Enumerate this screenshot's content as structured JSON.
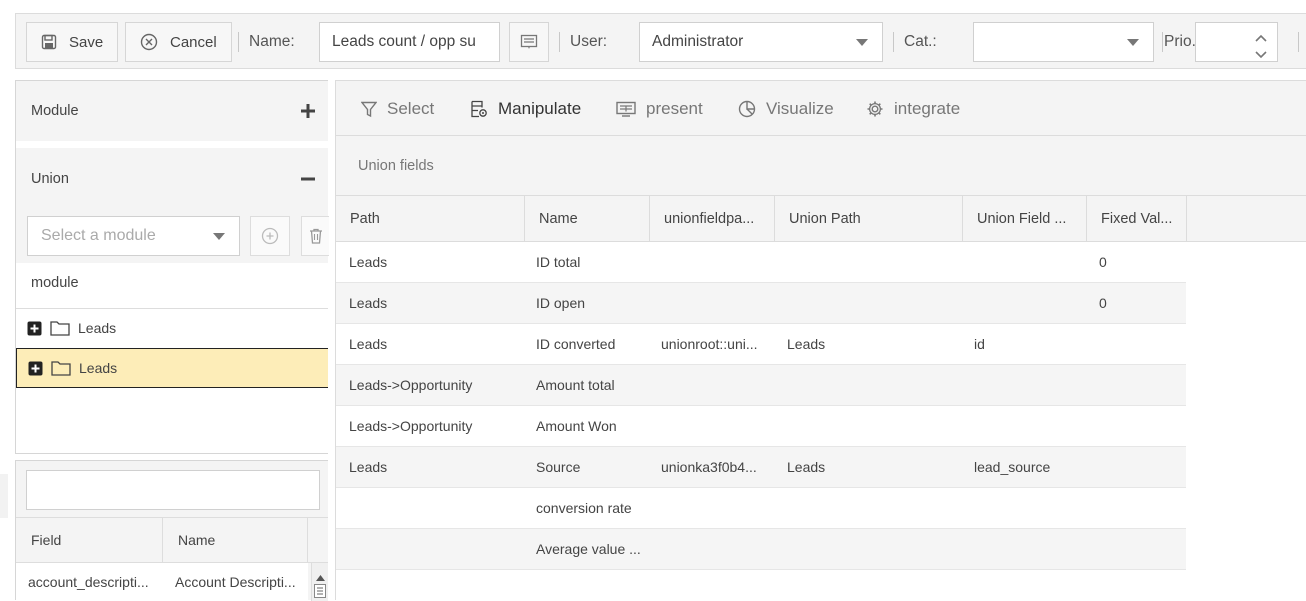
{
  "toolbar": {
    "save_label": "Save",
    "cancel_label": "Cancel",
    "name_label": "Name:",
    "name_value": "Leads count / opp su",
    "user_label": "User:",
    "user_value": "Administrator",
    "cat_label": "Cat.:",
    "cat_value": "",
    "prio_label": "Prio."
  },
  "left": {
    "module_header": "Module",
    "union_header": "Union",
    "select_placeholder": "Select a module",
    "tree_title": "module",
    "tree_items": [
      {
        "label": "Leads",
        "selected": false
      },
      {
        "label": "Leads",
        "selected": true
      }
    ],
    "field_table": {
      "headers": [
        "Field",
        "Name"
      ],
      "rows": [
        [
          "account_descripti...",
          "Account Descripti..."
        ]
      ]
    }
  },
  "tabs": [
    {
      "label": "Select",
      "icon": "filter-icon",
      "active": false
    },
    {
      "label": "Manipulate",
      "icon": "manipulate-icon",
      "active": true
    },
    {
      "label": "present",
      "icon": "present-icon",
      "active": false
    },
    {
      "label": "Visualize",
      "icon": "pie-chart-icon",
      "active": false
    },
    {
      "label": "integrate",
      "icon": "gear-icon",
      "active": false
    }
  ],
  "section_title": "Union fields",
  "grid": {
    "headers": [
      "Path",
      "Name",
      "unionfieldpa...",
      "Union Path",
      "Union Field ...",
      "Fixed Val..."
    ],
    "rows": [
      [
        "Leads",
        "ID total",
        "",
        "",
        "",
        "0"
      ],
      [
        "Leads",
        "ID open",
        "",
        "",
        "",
        "0"
      ],
      [
        "Leads",
        "ID converted",
        "unionroot::uni...",
        "Leads",
        "id",
        ""
      ],
      [
        "Leads->Opportunity",
        "Amount total",
        "",
        "",
        "",
        ""
      ],
      [
        "Leads->Opportunity",
        "Amount Won",
        "",
        "",
        "",
        ""
      ],
      [
        "Leads",
        "Source",
        "unionka3f0b4...",
        "Leads",
        "lead_source",
        ""
      ],
      [
        "",
        "conversion rate",
        "",
        "",
        "",
        ""
      ],
      [
        "",
        "Average value ...",
        "",
        "",
        "",
        ""
      ]
    ]
  },
  "colors": {
    "panel_bg": "#f4f4f4",
    "border": "#dcdcdc",
    "selected_row": "#fdedb8"
  }
}
